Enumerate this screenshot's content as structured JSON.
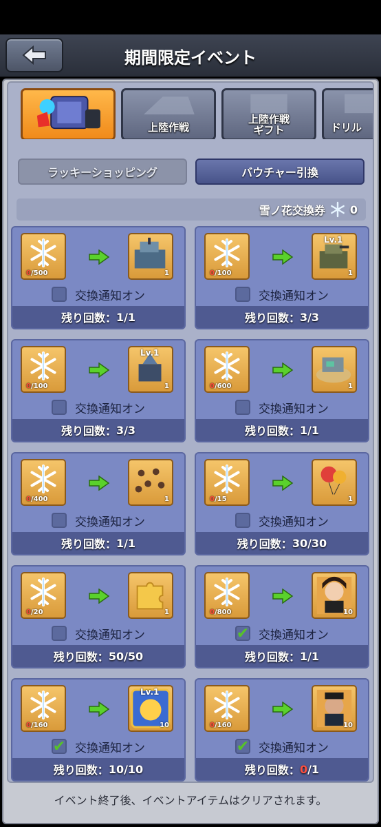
{
  "header": {
    "title": "期間限定イベント",
    "back_glyph": "⬅"
  },
  "tabs": [
    {
      "label": "",
      "active": true,
      "icon": "event-chest-icon"
    },
    {
      "label": "上陸作戦",
      "active": false,
      "icon": "tank-silhouette-icon"
    },
    {
      "label": "上陸作戦\nギフト",
      "active": false,
      "icon": "gift-silhouette-icon"
    },
    {
      "label": "ドリル",
      "active": false,
      "icon": "drill-silhouette-icon"
    }
  ],
  "subtabs": {
    "lucky": "ラッキーショッピング",
    "voucher": "バウチャー引換"
  },
  "currency": {
    "label": "雪ノ花交換券",
    "amount": "0"
  },
  "notify_label": "交換通知オン",
  "remain_prefix": "残り回数：",
  "items": [
    {
      "have": "0",
      "need": "/500",
      "qty": "1",
      "lv": "",
      "reward": "tank-building",
      "checked": false,
      "remain": "1/1",
      "zero": false
    },
    {
      "have": "0",
      "need": "/100",
      "qty": "1",
      "lv": "Lv.1",
      "reward": "artillery-building",
      "checked": false,
      "remain": "3/3",
      "zero": false
    },
    {
      "have": "0",
      "need": "/100",
      "qty": "1",
      "lv": "Lv.1",
      "reward": "radar-tower",
      "checked": false,
      "remain": "3/3",
      "zero": false
    },
    {
      "have": "0",
      "need": "/600",
      "qty": "1",
      "lv": "",
      "reward": "island-base",
      "checked": false,
      "remain": "1/1",
      "zero": false
    },
    {
      "have": "0",
      "need": "/400",
      "qty": "1",
      "lv": "",
      "reward": "paratroopers",
      "checked": false,
      "remain": "1/1",
      "zero": false
    },
    {
      "have": "0",
      "need": "/15",
      "qty": "1",
      "lv": "",
      "reward": "balloons",
      "checked": false,
      "remain": "30/30",
      "zero": false
    },
    {
      "have": "0",
      "need": "/20",
      "qty": "1",
      "lv": "",
      "reward": "puzzle-piece",
      "checked": false,
      "remain": "50/50",
      "zero": false
    },
    {
      "have": "0",
      "need": "/800",
      "qty": "10",
      "lv": "",
      "reward": "hero-portrait-female",
      "checked": true,
      "remain": "1/1",
      "zero": false
    },
    {
      "have": "0",
      "need": "/160",
      "qty": "10",
      "lv": "Lv.1",
      "reward": "golden-card",
      "checked": true,
      "remain": "10/10",
      "zero": false
    },
    {
      "have": "0",
      "need": "/160",
      "qty": "10",
      "lv": "",
      "reward": "hero-portrait-male",
      "checked": true,
      "remain_value": "0",
      "remain_rest": "/1",
      "remain": "0/1",
      "zero": true
    }
  ],
  "footer": "イベント終了後、イベントアイテムはクリアされます。"
}
